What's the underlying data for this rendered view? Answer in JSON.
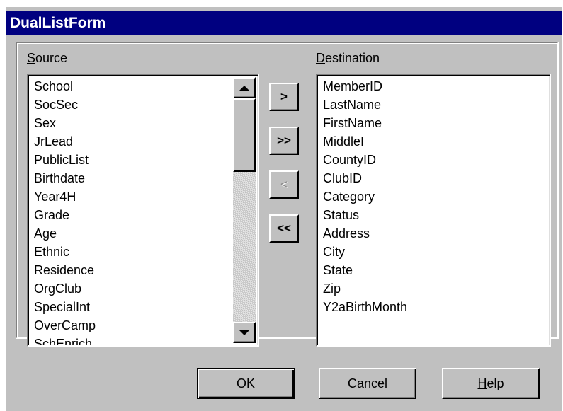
{
  "window": {
    "title": "DualListForm"
  },
  "source": {
    "label_accel": "S",
    "label_rest": "ource",
    "items": [
      "School",
      "SocSec",
      "Sex",
      "JrLead",
      "PublicList",
      "Birthdate",
      "Year4H",
      "Grade",
      "Age",
      "Ethnic",
      "Residence",
      "OrgClub",
      "SpecialInt",
      "OverCamp",
      "SchEnrich"
    ]
  },
  "destination": {
    "label_accel": "D",
    "label_rest": "estination",
    "items": [
      "MemberID",
      "LastName",
      "FirstName",
      "MiddleI",
      "CountyID",
      "ClubID",
      "Category",
      "Status",
      "Address",
      "City",
      "State",
      "Zip",
      "Y2aBirthMonth"
    ]
  },
  "move_buttons": {
    "include": ">",
    "include_all": ">>",
    "exclude": "<",
    "exclude_all": "<<"
  },
  "buttons": {
    "ok": "OK",
    "cancel": "Cancel",
    "help_accel": "H",
    "help_rest": "elp"
  },
  "icons": {
    "scroll_up": "scroll-up-arrow-icon",
    "scroll_down": "scroll-down-arrow-icon"
  },
  "colors": {
    "titlebar": "#000080",
    "face": "#c0c0c0"
  }
}
